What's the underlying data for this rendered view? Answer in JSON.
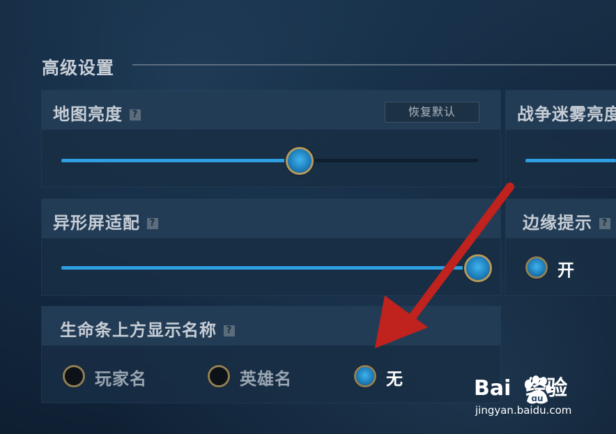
{
  "section": {
    "title": "高级设置"
  },
  "map_brightness": {
    "title": "地图亮度",
    "help_icon": "?",
    "reset_label": "恢复默认",
    "value_fraction": 0.6
  },
  "fog_brightness": {
    "title": "战争迷雾亮度"
  },
  "notch_adapt": {
    "title": "异形屏适配",
    "help_icon": "?",
    "value_fraction": 1.0
  },
  "edge_hint": {
    "title": "边缘提示",
    "option_on": "开"
  },
  "health_bar_name": {
    "title": "生命条上方显示名称",
    "help_icon": "?",
    "options": [
      "玩家名",
      "英雄名",
      "无"
    ],
    "selected": "无"
  },
  "watermark": {
    "logo": "Bai  经验",
    "sub": "jingyan.baidu.com"
  },
  "colors": {
    "accent": "#2e9fe0",
    "arrow": "#c0221e",
    "thumb_ring": "#b39a5e"
  }
}
